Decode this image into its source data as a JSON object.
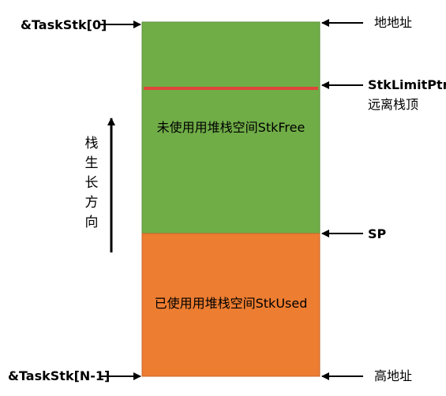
{
  "left_labels": {
    "stack_base": "&TaskStk[0]",
    "stack_end": "&TaskStk[N-1]"
  },
  "right_labels": {
    "low_address": "地地址",
    "limit_ptr": "StkLimitPtr",
    "limit_desc": "远离栈顶",
    "sp": "SP",
    "high_address": "高地址"
  },
  "regions": {
    "free": {
      "label": "未使用用堆栈空间StkFree",
      "color": "#70ad47"
    },
    "used": {
      "label": "已使用用堆栈空间StkUsed",
      "color": "#ed7d31"
    }
  },
  "limit_line_color": "#e0453a",
  "growth": {
    "chars": [
      "栈",
      "生",
      "长",
      "方",
      "向"
    ]
  }
}
